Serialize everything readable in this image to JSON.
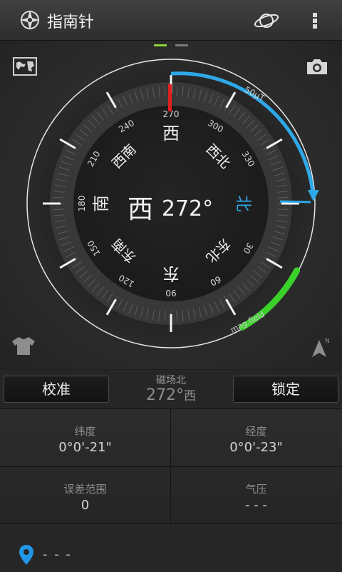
{
  "app": {
    "title": "指南针"
  },
  "pager": {
    "active_color": "#8fd33a",
    "inactive_color": "#7a7a7a"
  },
  "dial": {
    "heading_degrees": 272,
    "heading_direction": "西",
    "heading_text": "272°",
    "north_label": "北",
    "ring_directions": [
      "西",
      "西北",
      "东北",
      "东",
      "东南",
      "南",
      "西南"
    ],
    "tick_labels": [
      "270",
      "300",
      "330",
      "30",
      "60",
      "90",
      "120",
      "150",
      "180",
      "210",
      "240"
    ],
    "field_strength_label": "50μT",
    "mag_field_label": "mag.field",
    "field_arc_color": "#2ea8e8",
    "mag_arc_color": "#3bd12b",
    "needle_color": "#e02020"
  },
  "actions": {
    "calibrate_label": "校准",
    "lock_label": "锁定",
    "magnetic_north_label": "磁场北",
    "magnetic_north_value": "272°",
    "magnetic_north_unit": "西"
  },
  "info": {
    "latitude_label": "纬度",
    "latitude_value": "0°0'-21\"",
    "longitude_label": "经度",
    "longitude_value": "0°0'-23\"",
    "error_label": "误差范围",
    "error_value": "0",
    "pressure_label": "气压",
    "pressure_value": "- - -"
  },
  "location": {
    "text": "- - -",
    "icon_color": "#2196e6"
  }
}
